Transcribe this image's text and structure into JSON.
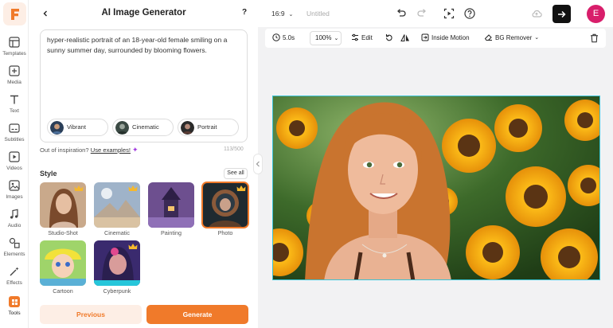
{
  "sidebar": {
    "items": [
      {
        "label": "Templates"
      },
      {
        "label": "Media"
      },
      {
        "label": "Text"
      },
      {
        "label": "Subtitles"
      },
      {
        "label": "Videos"
      },
      {
        "label": "Images"
      },
      {
        "label": "Audio"
      },
      {
        "label": "Elements"
      },
      {
        "label": "Effects"
      },
      {
        "label": "Tools"
      }
    ],
    "active": "Tools"
  },
  "panel": {
    "title": "AI Image Generator",
    "help": "?",
    "prompt": "hyper-realistic portrait of an 18-year-old female smiling on a sunny summer day, surrounded by blooming flowers.",
    "chips": [
      {
        "label": "Vibrant"
      },
      {
        "label": "Cinematic"
      },
      {
        "label": "Portrait"
      }
    ],
    "inspire_text": "Out of inspiration?",
    "inspire_link": "Use examples!",
    "counter": "113/500",
    "style_heading": "Style",
    "see_all": "See all",
    "styles": [
      {
        "label": "Studio-Shot",
        "premium": true
      },
      {
        "label": "Cinematic",
        "premium": true
      },
      {
        "label": "Painting",
        "premium": false
      },
      {
        "label": "Photo",
        "premium": true
      },
      {
        "label": "Cartoon",
        "premium": false
      },
      {
        "label": "Cyberpunk",
        "premium": true
      }
    ],
    "selected_style": "Photo",
    "previous": "Previous",
    "generate": "Generate"
  },
  "topbar": {
    "ratio": "16:9",
    "doc_title": "Untitled",
    "avatar_letter": "E"
  },
  "toolbar": {
    "duration": "5.0s",
    "zoom": "100%",
    "edit": "Edit",
    "inside_motion": "Inside Motion",
    "bg_remover": "BG Remover"
  },
  "colors": {
    "accent": "#f07a2a",
    "accent_light": "#fdeee5",
    "avatar": "#d81e6b",
    "selection": "#39c3d6"
  }
}
